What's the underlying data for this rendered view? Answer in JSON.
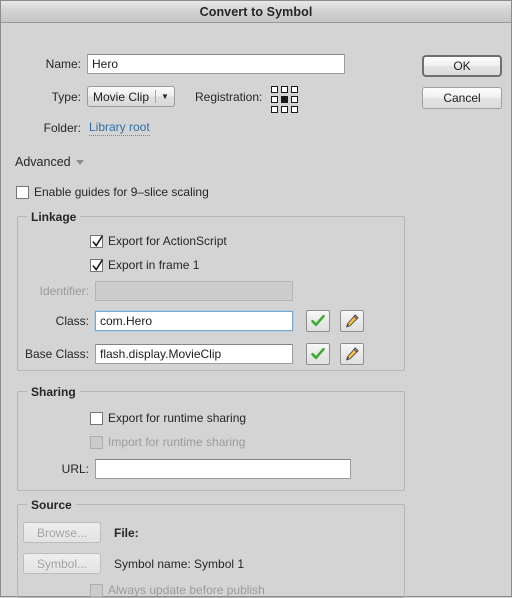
{
  "window": {
    "title": "Convert to Symbol"
  },
  "buttons": {
    "ok": "OK",
    "cancel": "Cancel"
  },
  "fields": {
    "name_label": "Name:",
    "name_value": "Hero",
    "type_label": "Type:",
    "type_value": "Movie Clip",
    "registration_label": "Registration:",
    "folder_label": "Folder:",
    "folder_link": "Library root"
  },
  "registration": {
    "selected_index": 4,
    "cells": [
      0,
      0,
      0,
      0,
      1,
      0,
      0,
      0,
      0
    ]
  },
  "advanced": {
    "label": "Advanced"
  },
  "nine_slice": {
    "label": "Enable guides for 9–slice scaling",
    "checked": false
  },
  "linkage": {
    "title": "Linkage",
    "export_actionscript": {
      "label": "Export for ActionScript",
      "checked": true
    },
    "export_frame1": {
      "label": "Export in frame 1",
      "checked": true
    },
    "identifier_label": "Identifier:",
    "identifier_value": "",
    "class_label": "Class:",
    "class_value": "com.Hero",
    "base_class_label": "Base Class:",
    "base_class_value": "flash.display.MovieClip"
  },
  "sharing": {
    "title": "Sharing",
    "export_runtime": {
      "label": "Export for runtime sharing",
      "checked": false
    },
    "import_runtime": {
      "label": "Import for runtime sharing",
      "checked": false
    },
    "url_label": "URL:",
    "url_value": ""
  },
  "source": {
    "title": "Source",
    "browse_button": "Browse...",
    "file_label": "File:",
    "symbol_button": "Symbol...",
    "symbol_name_label": "Symbol name: Symbol 1",
    "always_update": {
      "label": "Always update before publish",
      "checked": false
    }
  },
  "colors": {
    "dialog_bg": "#d4d4d4",
    "link": "#2f6fa8",
    "focus_border": "#7aa7cc",
    "check_green": "#3faa35",
    "text": "#262626",
    "disabled_text": "#9b9b9b"
  }
}
